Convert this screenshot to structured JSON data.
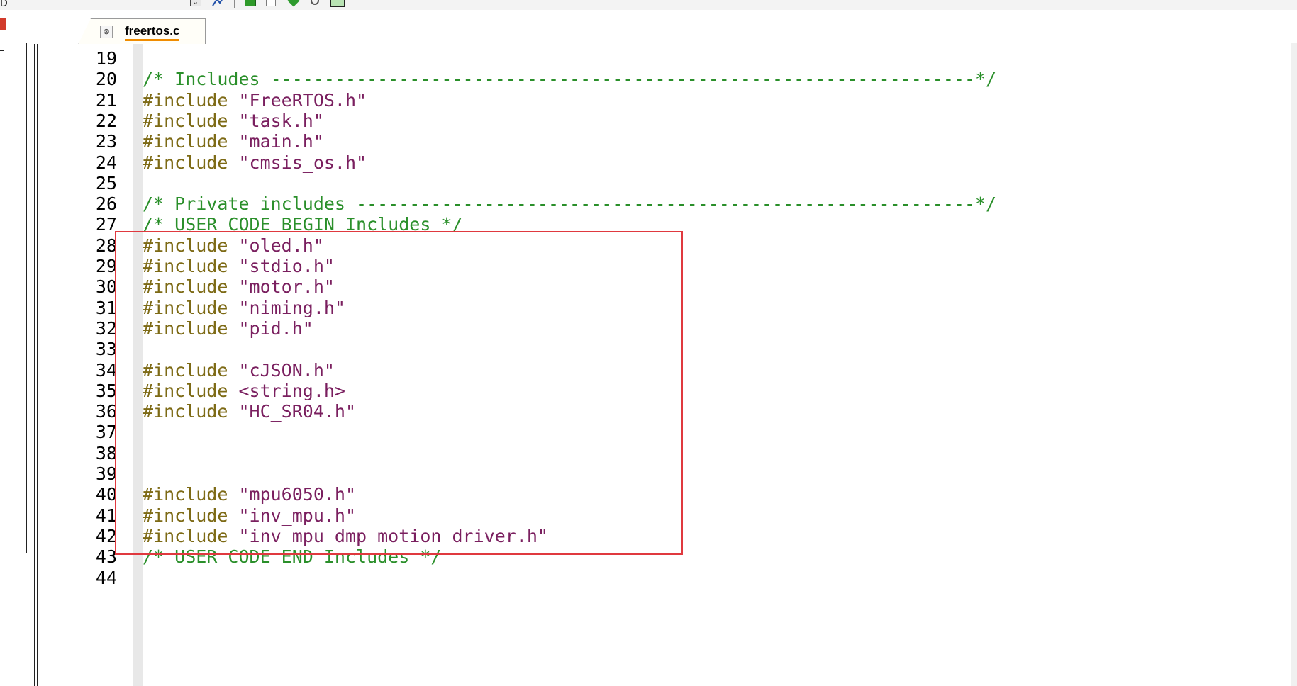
{
  "toolbar": {
    "left_letter": "D",
    "icons": [
      "dropdown-chevron-icon",
      "tool-icon",
      "build-icon",
      "document-icon",
      "download-diamond-icon",
      "debug-ring-icon",
      "image-icon"
    ]
  },
  "tab": {
    "filename": "freertos.c",
    "icon": "c-file-icon"
  },
  "editor": {
    "lines": [
      {
        "num": "19",
        "parts": []
      },
      {
        "num": "20",
        "parts": [
          {
            "t": "/* Includes ------------------------------------------------------------------*/",
            "k": "comment"
          }
        ]
      },
      {
        "num": "21",
        "parts": [
          {
            "t": "#include ",
            "k": "directive"
          },
          {
            "t": "\"FreeRTOS.h\"",
            "k": "string"
          }
        ]
      },
      {
        "num": "22",
        "parts": [
          {
            "t": "#include ",
            "k": "directive"
          },
          {
            "t": "\"task.h\"",
            "k": "string"
          }
        ]
      },
      {
        "num": "23",
        "parts": [
          {
            "t": "#include ",
            "k": "directive"
          },
          {
            "t": "\"main.h\"",
            "k": "string"
          }
        ]
      },
      {
        "num": "24",
        "parts": [
          {
            "t": "#include ",
            "k": "directive"
          },
          {
            "t": "\"cmsis_os.h\"",
            "k": "string"
          }
        ]
      },
      {
        "num": "25",
        "parts": []
      },
      {
        "num": "26",
        "parts": [
          {
            "t": "/* Private includes ----------------------------------------------------------*/",
            "k": "comment"
          }
        ]
      },
      {
        "num": "27",
        "parts": [
          {
            "t": "/* USER CODE BEGIN Includes */",
            "k": "comment"
          }
        ]
      },
      {
        "num": "28",
        "parts": [
          {
            "t": "#include ",
            "k": "directive"
          },
          {
            "t": "\"oled.h\"",
            "k": "string"
          }
        ]
      },
      {
        "num": "29",
        "parts": [
          {
            "t": "#include ",
            "k": "directive"
          },
          {
            "t": "\"stdio.h\"",
            "k": "string"
          }
        ]
      },
      {
        "num": "30",
        "parts": [
          {
            "t": "#include ",
            "k": "directive"
          },
          {
            "t": "\"motor.h\"",
            "k": "string"
          }
        ]
      },
      {
        "num": "31",
        "parts": [
          {
            "t": "#include ",
            "k": "directive"
          },
          {
            "t": "\"niming.h\"",
            "k": "string"
          }
        ]
      },
      {
        "num": "32",
        "parts": [
          {
            "t": "#include ",
            "k": "directive"
          },
          {
            "t": "\"pid.h\"",
            "k": "string"
          }
        ]
      },
      {
        "num": "33",
        "parts": []
      },
      {
        "num": "34",
        "parts": [
          {
            "t": "#include ",
            "k": "directive"
          },
          {
            "t": "\"cJSON.h\"",
            "k": "string"
          }
        ]
      },
      {
        "num": "35",
        "parts": [
          {
            "t": "#include ",
            "k": "directive"
          },
          {
            "t": "<string.h>",
            "k": "string"
          }
        ]
      },
      {
        "num": "36",
        "parts": [
          {
            "t": "#include ",
            "k": "directive"
          },
          {
            "t": "\"HC_SR04.h\"",
            "k": "string"
          }
        ]
      },
      {
        "num": "37",
        "parts": []
      },
      {
        "num": "38",
        "parts": []
      },
      {
        "num": "39",
        "parts": []
      },
      {
        "num": "40",
        "parts": [
          {
            "t": "#include ",
            "k": "directive"
          },
          {
            "t": "\"mpu6050.h\"",
            "k": "string"
          }
        ]
      },
      {
        "num": "41",
        "parts": [
          {
            "t": "#include ",
            "k": "directive"
          },
          {
            "t": "\"inv_mpu.h\"",
            "k": "string"
          }
        ]
      },
      {
        "num": "42",
        "parts": [
          {
            "t": "#include ",
            "k": "directive"
          },
          {
            "t": "\"inv_mpu_dmp_motion_driver.h\"",
            "k": "string"
          }
        ]
      },
      {
        "num": "43",
        "parts": [
          {
            "t": "/* USER CODE END Includes */",
            "k": "comment"
          }
        ]
      },
      {
        "num": "44",
        "parts": []
      }
    ]
  },
  "colors": {
    "comment": "#2a8f2a",
    "directive": "#7d6a15",
    "string": "#7a1f5f",
    "highlight_box": "#e0393f",
    "tab_underline": "#f08c00"
  }
}
